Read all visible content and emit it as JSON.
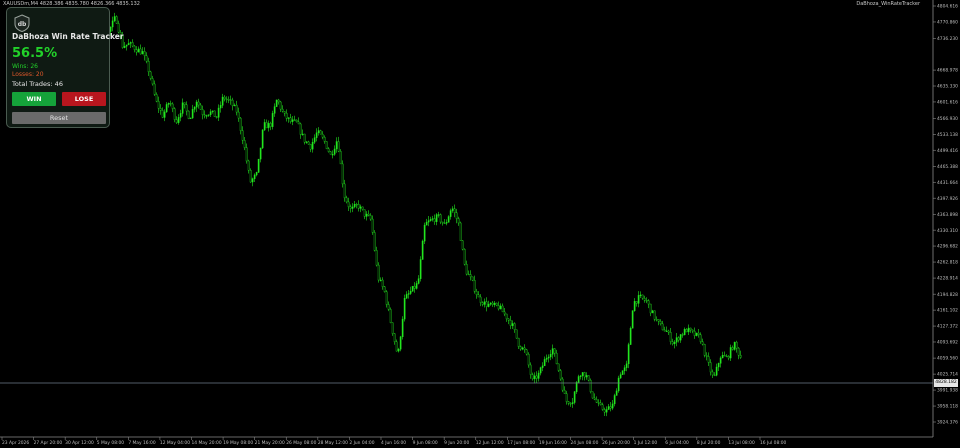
{
  "header": {
    "symbol_info": "XAUUSDm,M4 4828.386 4835.780 4826.366 4835.132",
    "indicator_label": "DaBhoza_WinRateTracker"
  },
  "tracker": {
    "logo_text": "db",
    "title": "DaBhoza Win Rate Tracker",
    "win_rate": "56.5%",
    "wins": "Wins: 26",
    "losses": "Losses: 20",
    "total": "Total Trades: 46",
    "win_button": "WIN",
    "lose_button": "LOSE",
    "reset_button": "Reset"
  },
  "colors": {
    "background": "#000000",
    "candles": "#22e61e",
    "axis": "#8a8a8a",
    "current_price_line": "#6e7c8c",
    "win_color": "#22d22a",
    "loss_color": "#e0582a"
  },
  "current_price": "4828.182",
  "chart_data": {
    "type": "candlestick",
    "y_ticks": [
      "4804.616",
      "4770.860",
      "4736.230",
      "4668.978",
      "4635.330",
      "4601.616",
      "4566.930",
      "4533.138",
      "4499.416",
      "4465.388",
      "4431.664",
      "4397.926",
      "4363.898",
      "4330.310",
      "4296.682",
      "4262.818",
      "4228.914",
      "4194.828",
      "4161.102",
      "4127.372",
      "4093.692",
      "4059.560",
      "4025.714",
      "3991.938",
      "3958.118",
      "3924.376"
    ],
    "y_range": [
      3924.376,
      4804.616
    ],
    "x_ticks": [
      "23 Apr 2026",
      "27 Apr 20:00",
      "30 Apr 12:00",
      "5 May 08:00",
      "7 May 16:00",
      "12 May 04:00",
      "14 May 20:00",
      "19 May 08:00",
      "21 May 20:00",
      "26 May 08:00",
      "28 May 12:00",
      "2 Jun 04:00",
      "4 Jun 16:00",
      "9 Jun 08:00",
      "9 Jun 20:00",
      "12 Jun 12:00",
      "17 Jun 08:00",
      "19 Jun 16:00",
      "24 Jun 08:00",
      "26 Jun 20:00",
      "1 Jul 12:00",
      "6 Jul 04:00",
      "8 Jul 20:00",
      "13 Jul 08:00",
      "16 Jul 08:00"
    ],
    "close_path": [
      4640,
      4698,
      4712,
      4726,
      4700,
      4716,
      4722,
      4744,
      4704,
      4752,
      4782,
      4720,
      4724,
      4714,
      4706,
      4664,
      4602,
      4572,
      4604,
      4560,
      4596,
      4568,
      4606,
      4576,
      4580,
      4570,
      4612,
      4602,
      4582,
      4518,
      4432,
      4448,
      4552,
      4552,
      4608,
      4574,
      4560,
      4556,
      4522,
      4508,
      4538,
      4520,
      4488,
      4524,
      4404,
      4372,
      4384,
      4364,
      4352,
      4232,
      4200,
      4130,
      4062,
      4184,
      4202,
      4218,
      4342,
      4352,
      4358,
      4340,
      4380,
      4346,
      4248,
      4222,
      4186,
      4174,
      4170,
      4168,
      4150,
      4130,
      4088,
      4072,
      4010,
      4026,
      4060,
      4080,
      4030,
      3968,
      3970,
      4030,
      4024,
      3978,
      3956,
      3948,
      3960,
      4028,
      4038,
      4176,
      4188,
      4180,
      4150,
      4128,
      4116,
      4090,
      4108,
      4120,
      4110,
      4102,
      4054,
      4014,
      4064,
      4060,
      4090,
      4062
    ]
  }
}
